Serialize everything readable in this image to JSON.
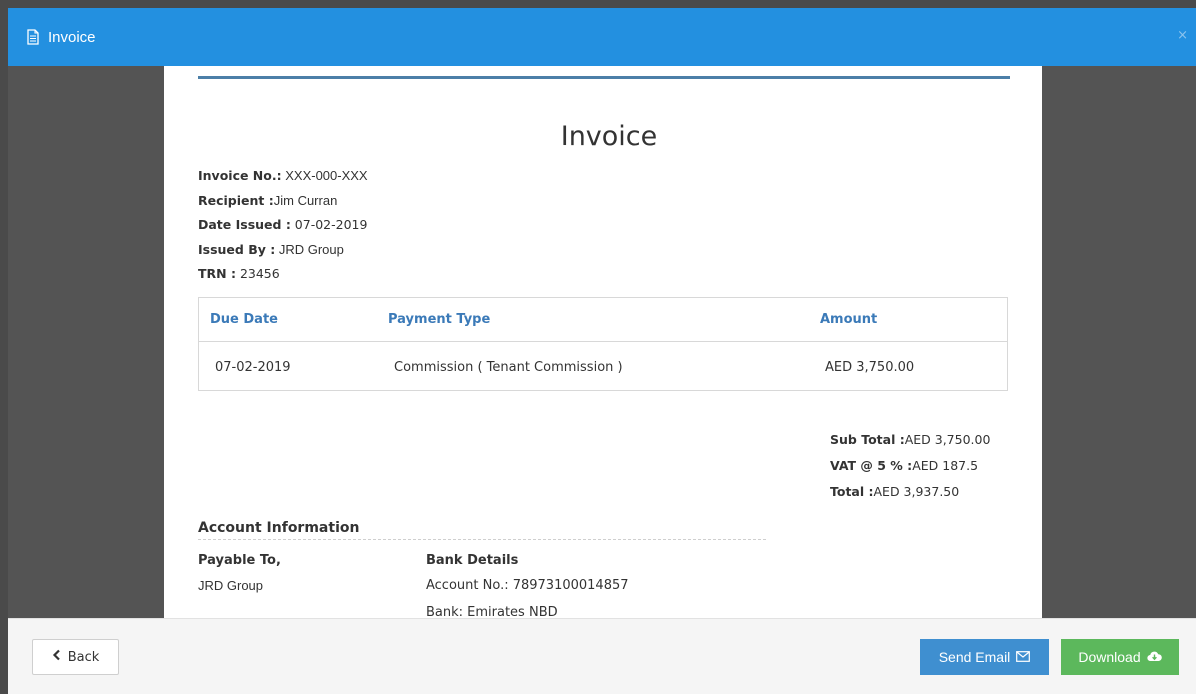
{
  "header": {
    "title": "Invoice",
    "icon": "document-icon",
    "color": "#2390e0"
  },
  "close": "×",
  "invoice": {
    "heading": "Invoice",
    "meta": {
      "invoice_no_label": "Invoice No.:",
      "invoice_no": " XXX-000-XXX",
      "recipient_label": "Recipient :",
      "recipient": "Jim Curran",
      "date_issued_label": "Date Issued :",
      "date_issued": " 07-02-2019",
      "issued_by_label": "Issued By :",
      "issued_by": " JRD Group",
      "trn_label": "TRN :",
      "trn": " 23456"
    },
    "table": {
      "headers": [
        "Due Date",
        "Payment Type",
        "Amount"
      ],
      "rows": [
        [
          "07-02-2019",
          "Commission ( Tenant Commission )",
          "AED 3,750.00"
        ]
      ]
    },
    "totals": {
      "sub_total_label": "Sub Total :",
      "sub_total": "AED 3,750.00",
      "vat_label": "VAT @ 5 % :",
      "vat": "AED 187.5",
      "total_label": "Total :",
      "total": "AED 3,937.50"
    },
    "account": {
      "title": "Account Information",
      "payable_to_label": "Payable To,",
      "payable_to": "JRD Group",
      "bank_details_label": "Bank Details",
      "account_no": "Account No.: 78973100014857",
      "bank": "Bank: Emirates NBD"
    }
  },
  "footer": {
    "back_label": "Back",
    "send_email_label": "Send Email",
    "download_label": "Download",
    "send_email_color": "#3f8fd0",
    "download_color": "#5cb85c"
  }
}
